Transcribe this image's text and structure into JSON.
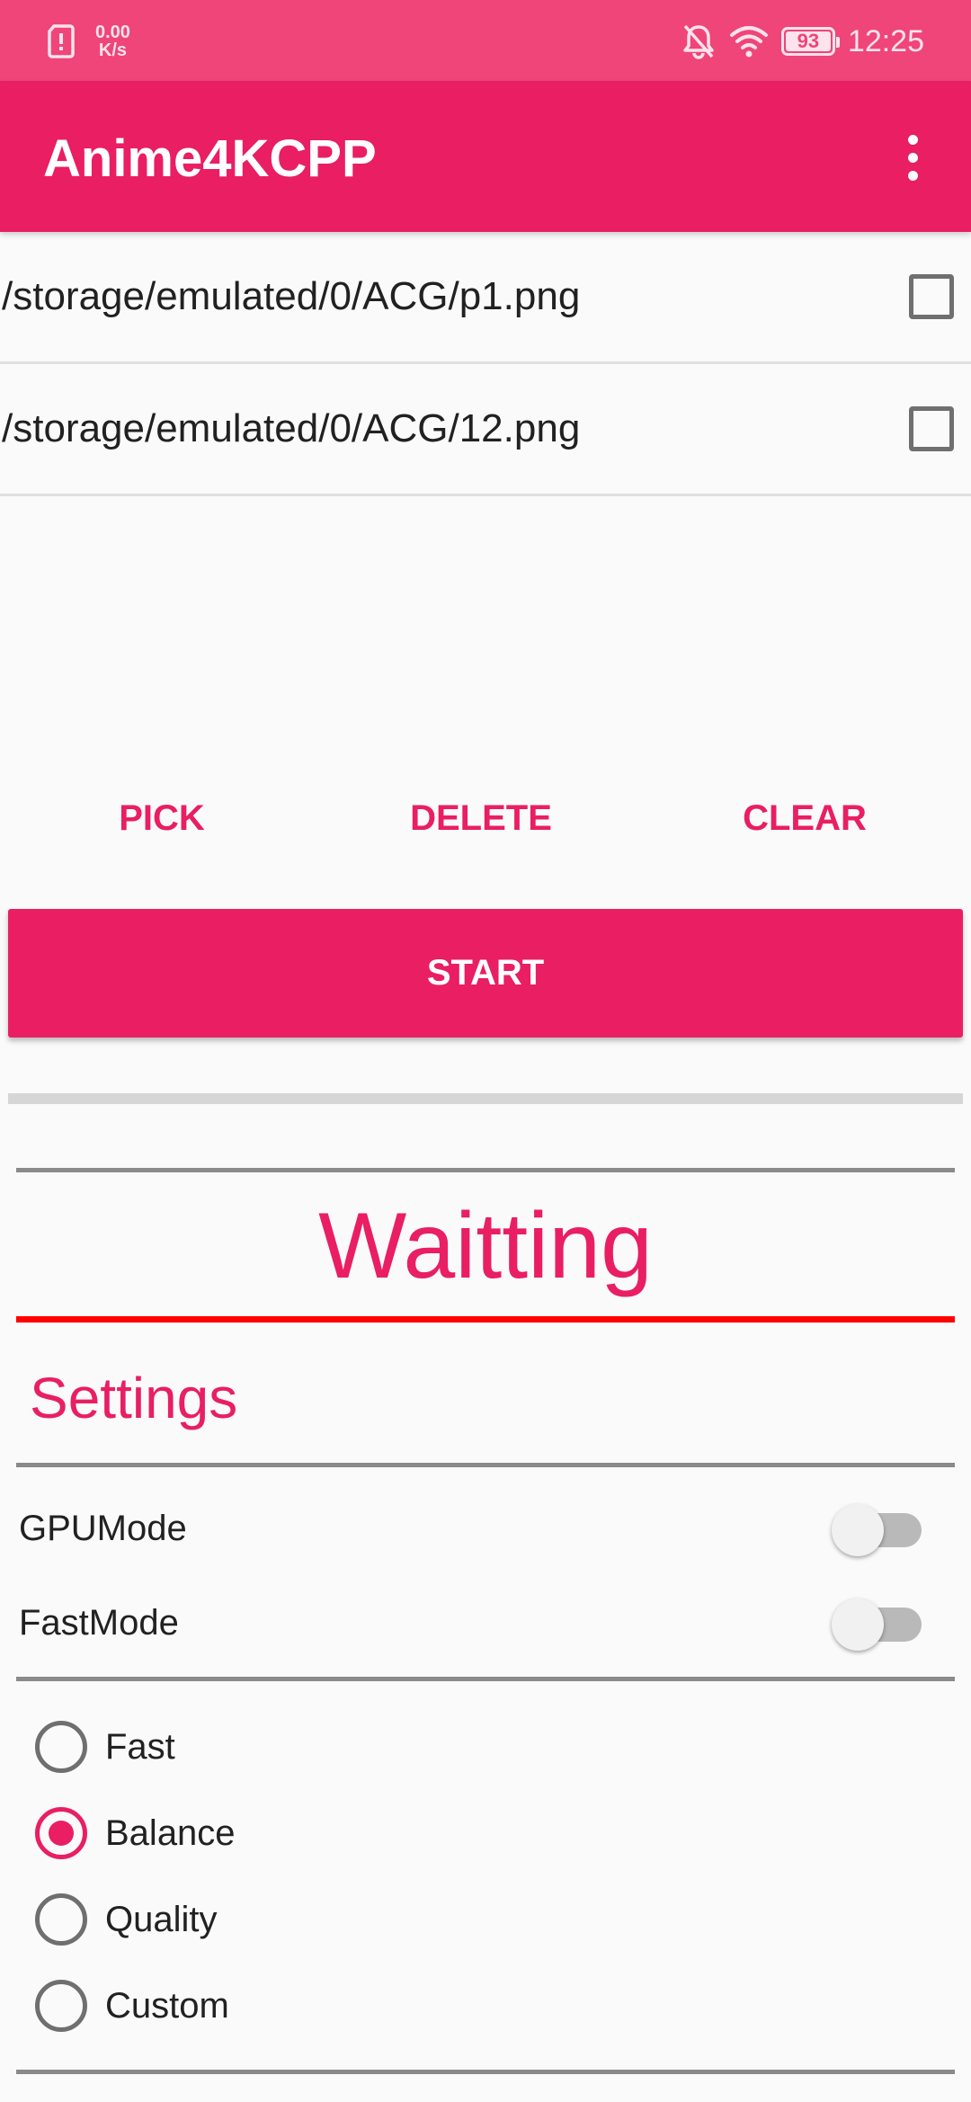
{
  "status_bar": {
    "sim_icon": "sim-card-icon",
    "net_speed_value": "0.00",
    "net_speed_unit": "K/s",
    "battery_level": "93",
    "time": "12:25"
  },
  "app_bar": {
    "title": "Anime4KCPP",
    "menu_icon": "more-vert-icon"
  },
  "files": [
    {
      "path": "/storage/emulated/0/ACG/p1.png",
      "checked": false
    },
    {
      "path": "/storage/emulated/0/ACG/12.png",
      "checked": false
    }
  ],
  "actions": {
    "pick": "PICK",
    "delete": "DELETE",
    "clear": "CLEAR",
    "start": "START"
  },
  "progress": {
    "value": 0
  },
  "status": {
    "text": "Waitting"
  },
  "settings": {
    "title": "Settings",
    "switches": [
      {
        "label": "GPUMode",
        "on": false
      },
      {
        "label": "FastMode",
        "on": false
      }
    ],
    "modes": [
      {
        "label": "Fast",
        "selected": false
      },
      {
        "label": "Balance",
        "selected": true
      },
      {
        "label": "Quality",
        "selected": false
      },
      {
        "label": "Custom",
        "selected": false
      }
    ]
  },
  "colors": {
    "primary": "#e91e63",
    "status_bar": "#ef4578",
    "accent_divider": "#ff0000"
  }
}
